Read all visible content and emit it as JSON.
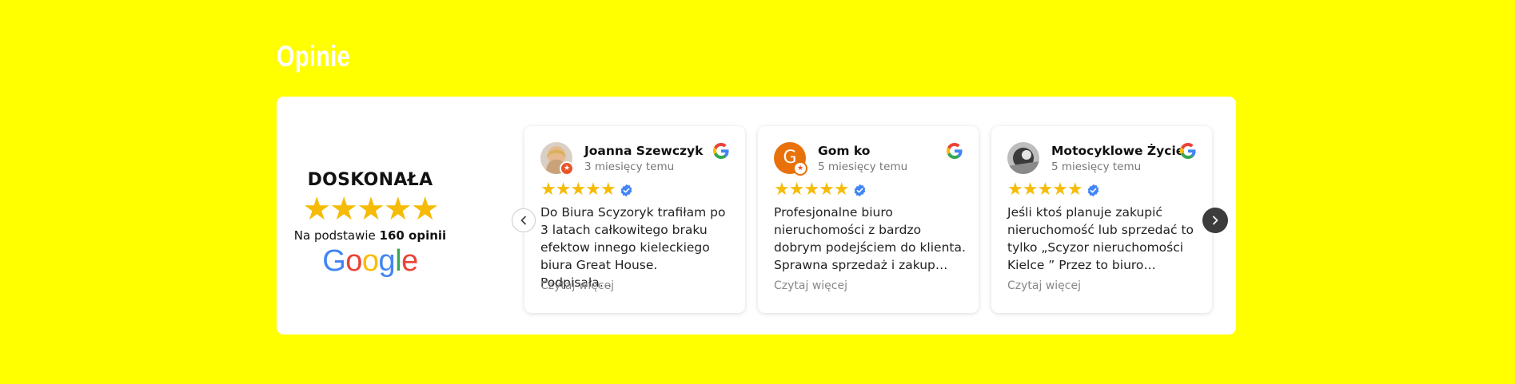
{
  "section": {
    "title": "Opinie"
  },
  "summary": {
    "rating_word": "DOSKONAŁA",
    "stars": "★★★★★",
    "based_on_prefix": "Na podstawie ",
    "based_on_count": "160 opinii",
    "provider": "Google"
  },
  "reviews": [
    {
      "name": "Joanna Szewczyk",
      "time": "3 miesięcy temu",
      "stars": "★★★★★",
      "text": "Do Biura Scyzoryk trafiłam po 3 latach całkowitego braku efektow innego kieleckiego biura Great House. Podpisała…",
      "read_more": "Czytaj więcej",
      "avatar": "photo"
    },
    {
      "name": "Gom ko",
      "time": "5 miesięcy temu",
      "stars": "★★★★★",
      "text": "Profesjonalne biuro nieruchomości z bardzo dobrym podejściem do klienta. Sprawna sprzedaż i zakup…",
      "read_more": "Czytaj więcej",
      "avatar_letter": "G",
      "avatar_color": "#e8710a"
    },
    {
      "name": "Motocyklowe Życie",
      "time": "5 miesięcy temu",
      "stars": "★★★★★",
      "text": "Jeśli ktoś planuje zakupić nieruchomość lub sprzedać to tylko „Scyzor nieruchomości Kielce ” Przez to biuro…",
      "read_more": "Czytaj więcej",
      "avatar": "photo-bw"
    }
  ],
  "colors": {
    "background": "#ffff00",
    "star": "#f6bb06",
    "verified": "#4285f4"
  },
  "icons": {
    "prev": "chevron-left-icon",
    "next": "chevron-right-icon",
    "provider": "google-g-icon",
    "verified": "verified-check-icon"
  }
}
